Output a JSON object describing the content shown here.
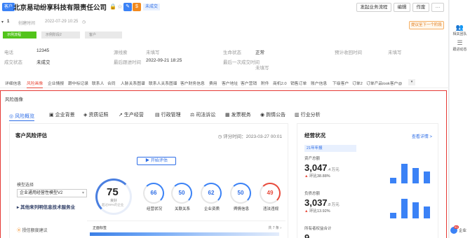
{
  "header": {
    "tag": "客户",
    "company": "北京易动纷享科技有限责任公司",
    "status": "未成交",
    "buttons": [
      "发起业务流程",
      "编辑",
      "作废"
    ],
    "id_num": "1",
    "created_label": "创建时间",
    "created_value": "2022-07-29 10:25",
    "remind": "提议至下一个阶段"
  },
  "stages": [
    "示例流程",
    "示例阶段2",
    "客户"
  ],
  "info": {
    "row1": [
      {
        "label": "电话",
        "value": "12345"
      },
      {
        "label": "源线索",
        "value": "未填写"
      },
      {
        "label": "生命状态",
        "value": "正常"
      },
      {
        "label": "预计收回时间",
        "value": "未填写"
      }
    ],
    "row2": [
      {
        "label": "成交状态",
        "value": "未成交"
      },
      {
        "label": "最后跟进时间",
        "value": "2022-09-21 18:25"
      },
      {
        "label": "最后一次成交时间",
        "value": "未填写"
      }
    ]
  },
  "tabs": [
    "详细信息",
    "风险画像",
    "企业情报",
    "跟中标记录",
    "联系人",
    "合同",
    "人脉关系图谱",
    "联系人关系图谱",
    "客户财务信息",
    "费用",
    "客户地址",
    "客户营销",
    "附件",
    "商机2.0",
    "销售订单",
    "账户信息",
    "下级客户",
    "订单2",
    "订单产品look客户@"
  ],
  "panel": {
    "title": "风险画像",
    "subtabs": [
      "风险概览",
      "企业背景",
      "资质证照",
      "生产经营",
      "行政管理",
      "司法诉讼",
      "发票税务",
      "舆情公告",
      "行业分析"
    ]
  },
  "risk": {
    "title": "客户风险评估",
    "date": "评分时间：2023-03-27 00:01",
    "start_button": "开始评估",
    "model_label": "模型选择",
    "model_value": "企业通用经营性模型V2",
    "model_link": "其他来列明信息技术服务业",
    "suggestion": "授信额度建议",
    "score": "75",
    "score_label": "良好",
    "score_note": "超过99%的企业",
    "dimensions": [
      {
        "value": "66",
        "label": "经营状况"
      },
      {
        "value": "50",
        "label": "关联关系"
      },
      {
        "value": "62",
        "label": "企业资质"
      },
      {
        "value": "50",
        "label": "舆情信息"
      },
      {
        "value": "49",
        "label": "违法违规"
      }
    ],
    "footer_label": "正面标签",
    "footer_count": "共 7 条"
  },
  "biz": {
    "title": "经营状况",
    "link": "查看详情 >",
    "year": "21年年报",
    "metrics": [
      {
        "label": "资产总额",
        "value": "3,047",
        "unit": ".4 万元",
        "change": "环比38.88%",
        "bars": [
          0.25,
          0.9,
          0.7,
          0.55
        ]
      },
      {
        "label": "负债总额",
        "value": "3,037",
        "unit": ".8 万元",
        "change": "环比13.92%",
        "bars": [
          0.25,
          0.9,
          0.75,
          0.55
        ]
      },
      {
        "label": "所有者权益合计",
        "value": "9",
        "unit": "",
        "change": "",
        "bars": []
      }
    ]
  },
  "side": [
    "相关团队",
    "跟进动态"
  ],
  "fab": {
    "badge": "61",
    "label": "企业"
  }
}
